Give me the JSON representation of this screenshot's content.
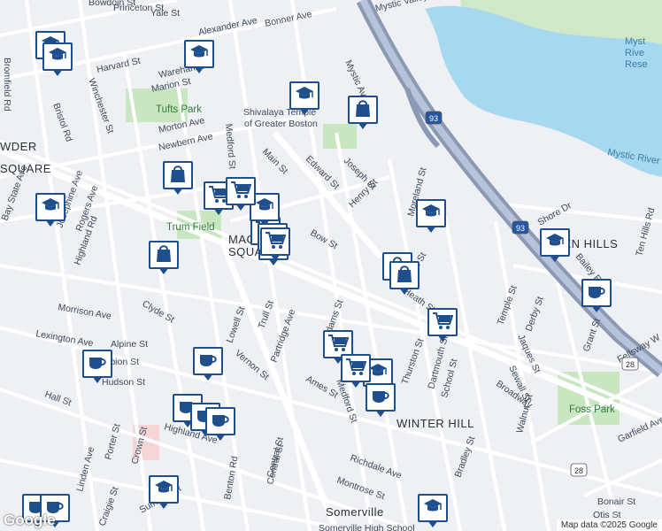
{
  "map": {
    "attribution": "Map data ©2025 Google",
    "logo": "Google",
    "colors": {
      "water": "#a6d8ef",
      "park": "#c8e6c0",
      "highway": "#8a9ab5",
      "road": "#ffffff",
      "marker_border": "#1f4e8c"
    }
  },
  "places": {
    "big": [
      "MAGOUN SQUARE",
      "WINTER HILL",
      "TEN HILLS",
      "Somerville",
      "POWDER HOUSE SQUARE"
    ],
    "parks": [
      "Tufts Park",
      "Trum Field",
      "Foss Park"
    ],
    "water": [
      "Mystic River Reservation",
      "Mystic River"
    ],
    "poi": [
      "Shivalaya Temple of Greater Boston",
      "Somerville High School"
    ]
  },
  "streets": [
    "Mystic Valley Pkwy",
    "Harvard St",
    "Bonner Ave",
    "Alexander Ave",
    "Yale St",
    "Princeton St",
    "Bowdoin St",
    "Wareham St",
    "Marion St",
    "Bromfield Rd",
    "Bristol Rd",
    "Winchester St",
    "Morton Ave",
    "Newbern Ave",
    "Medford St",
    "Main St",
    "Edward St",
    "Joseph St",
    "Henry St",
    "Mystic Ave",
    "Bow St",
    "Shore Dr",
    "Bay State Ave",
    "Josephine Ave",
    "Rogers Ave",
    "Highland Rd",
    "Clyde St",
    "Morrison Ave",
    "Lexington Ave",
    "Alpine St",
    "Albion St",
    "Hudson St",
    "Hall St",
    "Lowell St",
    "Trull St",
    "Partridge Ave",
    "Vernon St",
    "Adams St",
    "Central St",
    "Ames St",
    "Medford St",
    "Thurston St",
    "Dartmouth St",
    "School St",
    "Heath St",
    "Temple St",
    "Derby St",
    "Jaques St",
    "Sewall St",
    "Grant St",
    "Broadway",
    "Fellsway W",
    "Walnut St",
    "Garfield Ave",
    "Bonair St",
    "Otis St",
    "Bradley St",
    "Richdale Ave",
    "Montrose St",
    "Highland Ave",
    "Porter St",
    "Crown St",
    "Craigie St",
    "Summer St",
    "Linden Ave",
    "Benton Rd",
    "Central St",
    "Ten Hills Rd",
    "Bailey Rd",
    "Moreland St",
    "Rush St"
  ],
  "highway_shields": [
    "93",
    "93",
    "28",
    "28"
  ],
  "markers": [
    {
      "type": "school",
      "label": "school"
    },
    {
      "type": "school",
      "label": "school"
    },
    {
      "type": "school",
      "label": "school"
    },
    {
      "type": "school",
      "label": "school"
    },
    {
      "type": "school",
      "label": "school"
    },
    {
      "type": "school",
      "label": "school"
    },
    {
      "type": "school",
      "label": "school"
    },
    {
      "type": "school",
      "label": "school"
    },
    {
      "type": "school",
      "label": "school"
    },
    {
      "type": "shop",
      "label": "store"
    },
    {
      "type": "shop",
      "label": "store"
    },
    {
      "type": "shop",
      "label": "store"
    },
    {
      "type": "shop",
      "label": "store"
    },
    {
      "type": "shop",
      "label": "store"
    },
    {
      "type": "cart",
      "label": "grocery"
    },
    {
      "type": "cart",
      "label": "grocery"
    },
    {
      "type": "cart",
      "label": "grocery"
    },
    {
      "type": "cart",
      "label": "grocery"
    },
    {
      "type": "cart",
      "label": "grocery"
    },
    {
      "type": "cart",
      "label": "grocery"
    },
    {
      "type": "cafe",
      "label": "cafe"
    },
    {
      "type": "cafe",
      "label": "cafe"
    },
    {
      "type": "cafe",
      "label": "cafe"
    },
    {
      "type": "cafe",
      "label": "cafe"
    },
    {
      "type": "cafe",
      "label": "cafe"
    },
    {
      "type": "cafe",
      "label": "cafe"
    },
    {
      "type": "cafe",
      "label": "cafe"
    },
    {
      "type": "cafe",
      "label": "cafe"
    }
  ]
}
